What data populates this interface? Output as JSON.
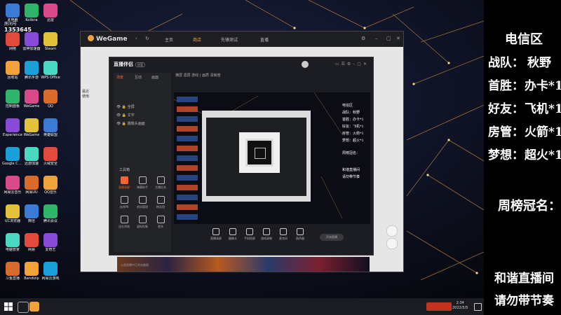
{
  "desktop": {
    "viewer_badge": {
      "label": "房间号",
      "count": "1353645"
    },
    "icons_col1": [
      "此电脑",
      "网络",
      "回收站",
      "控制面板",
      "Experience",
      "Google Chrome",
      "网易云音乐",
      "UC浏览器",
      "电脑管家",
      "斗鱼直播"
    ],
    "icons_col2": [
      "Kolibra",
      "雷神加速器",
      "腾讯手游",
      "WeGame",
      "WeGame",
      "迅游加速",
      "网易UU",
      "微信",
      "网易",
      "Bandizip"
    ],
    "icons_col3": [
      "迅雷",
      "Steam",
      "WPS Office",
      "QQ",
      "英雄联盟",
      "火绒安全",
      "QQ音乐",
      "腾讯会议",
      "爱奇艺",
      "网易云游戏"
    ]
  },
  "wegame": {
    "logo": "WeGame",
    "nav": [
      "主页",
      "商店",
      "先锋测试",
      "直播"
    ],
    "active_nav": "商店",
    "side_icons_label": "最近使用"
  },
  "companion": {
    "title": "直播伴侣",
    "title_tag": "房管",
    "tabs": [
      "场景",
      "互动",
      "画面"
    ],
    "layers": [
      "全屏",
      "文字",
      "摄像头画面"
    ],
    "tools_title": "工具箱",
    "tools": [
      "直播录屏",
      "弹幕助手",
      "主播任务",
      "连线PK",
      "房间管理",
      "粉丝团",
      "送礼特效",
      "虚拟形象",
      "更多"
    ],
    "toolbar_text": "横屏  竖屏  游戏  |  画质  清晰度",
    "bottom_text": "斗鱼直播中已开启美颜",
    "bottombar": [
      "直播录屏",
      "摄像头",
      "手机投屏",
      "游戏录制",
      "麦克风",
      "扬声器"
    ],
    "golive": "开始直播",
    "mini_panel": [
      "电信区",
      "战队：秋野",
      "首胜：办卡*1",
      "好友：飞机*1",
      "房管：火箭*1",
      "梦想：超火*1",
      "周榜冠名：",
      "和谐直播间",
      "请勿带节奏"
    ]
  },
  "right_panel": {
    "heading": "电信区",
    "rows": [
      {
        "label": "战队：",
        "value": "秋野"
      },
      {
        "label": "首胜：",
        "value": "办卡*1"
      },
      {
        "label": "好友：",
        "value": "飞机*1"
      },
      {
        "label": "房管：",
        "value": "火箭*1"
      },
      {
        "label": "梦想：",
        "value": "超火*1"
      }
    ],
    "weekly": "周榜冠名：",
    "footer1": "和谐直播间",
    "footer2": "请勿带节奏"
  },
  "taskbar": {
    "time": "2:34",
    "date": "2022/5/5"
  },
  "colors": {
    "accent": "#f2653a",
    "wegame_orange": "#f2a23a"
  }
}
